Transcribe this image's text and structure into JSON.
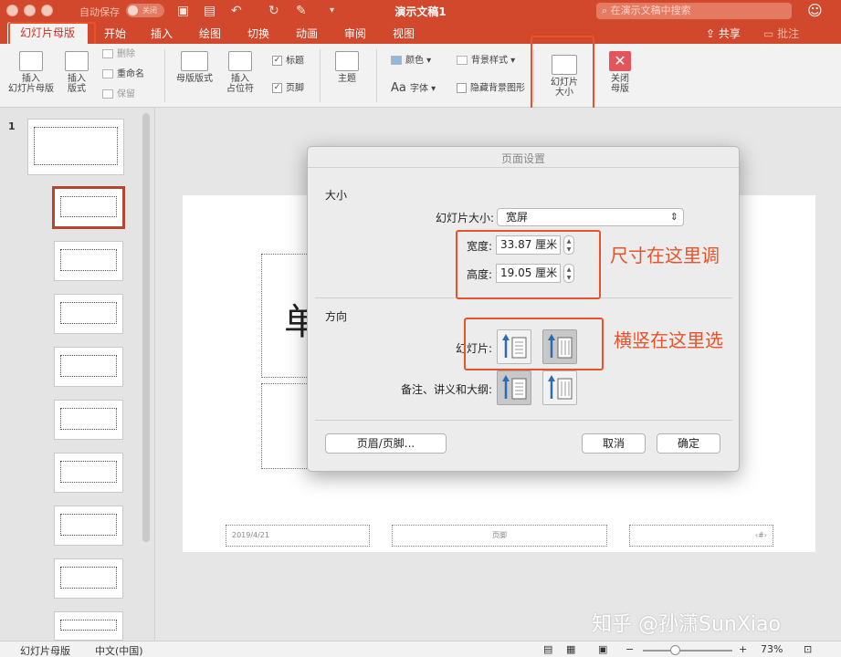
{
  "titlebar": {
    "autosave": "自动保存",
    "autosave_toggle": "关闭",
    "doc_title": "演示文稿1",
    "search_placeholder": "在演示文稿中搜索"
  },
  "tabs": {
    "active": "幻灯片母版",
    "items": [
      "开始",
      "插入",
      "绘图",
      "切换",
      "动画",
      "审阅",
      "视图"
    ],
    "share": "共享",
    "comment": "批注"
  },
  "ribbon": {
    "insert_master": "插入\n幻灯片母版",
    "insert_layout": "插入\n版式",
    "delete": "删除",
    "rename": "重命名",
    "preserve": "保留",
    "master_layout": "母版版式",
    "insert_placeholder": "插入\n占位符",
    "title_check": "标题",
    "footer_check": "页脚",
    "theme": "主题",
    "colors": "颜色",
    "fonts": "字体",
    "bg_style": "背景样式",
    "hide_bg": "隐藏背景图形",
    "slide_size": "幻灯片\n大小",
    "close_master": "关闭\n母版"
  },
  "panel": {
    "slide_number": "1"
  },
  "slide": {
    "big_char": "单",
    "date": "2019/4/21",
    "footer": "页脚",
    "number": "‹#›"
  },
  "dialog": {
    "title": "页面设置",
    "size_section": "大小",
    "slide_size_label": "幻灯片大小:",
    "slide_size_value": "宽屏",
    "width_label": "宽度:",
    "width_value": "33.87 厘米",
    "height_label": "高度:",
    "height_value": "19.05 厘米",
    "orientation_section": "方向",
    "slides_label": "幻灯片:",
    "notes_label": "备注、讲义和大纲:",
    "header_footer_button": "页眉/页脚...",
    "cancel_button": "取消",
    "ok_button": "确定"
  },
  "annotations": {
    "size_note": "尺寸在这里调",
    "orient_note": "横竖在这里选",
    "watermark": "知乎 @孙潇SunXiao"
  },
  "status": {
    "view": "幻灯片母版",
    "language": "中文(中国)",
    "zoom": "73%"
  },
  "colors": {
    "accent": "#d2482c",
    "annotation": "#e8532c"
  }
}
